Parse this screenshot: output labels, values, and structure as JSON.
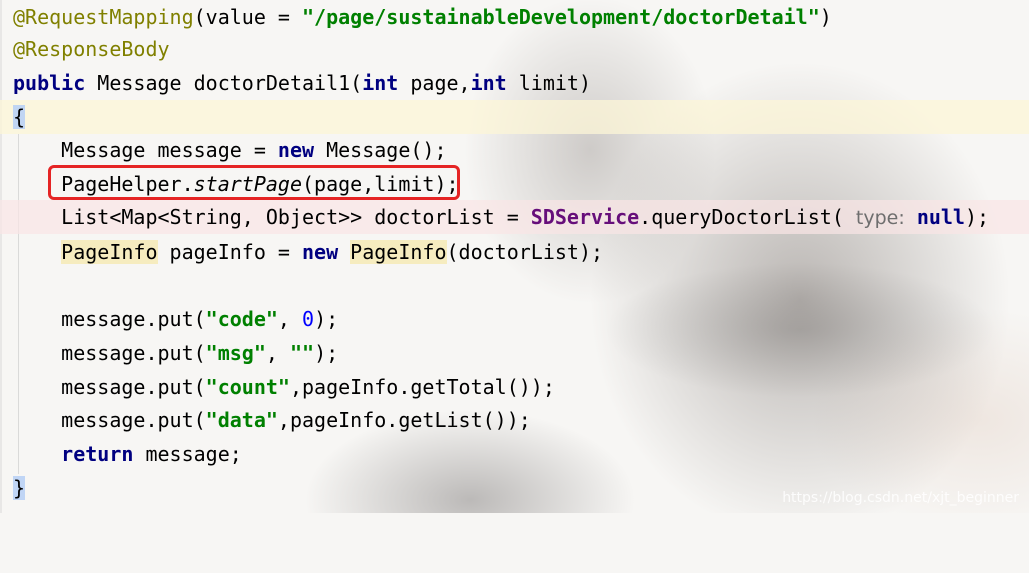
{
  "code": {
    "line1": {
      "annotation": "@RequestMapping",
      "paren_open": "(value = ",
      "string": "\"/page/sustainableDevelopment/doctorDetail\"",
      "paren_close": ")"
    },
    "line2": {
      "annotation": "@ResponseBody"
    },
    "line3": {
      "kw_public": "public",
      "rest1": " Message doctorDetail1(",
      "kw_int1": "int",
      "rest2": " page,",
      "kw_int2": "int",
      "rest3": " limit)"
    },
    "line4": {
      "brace": "{"
    },
    "line5": {
      "indent": "    ",
      "rest1": "Message message = ",
      "kw_new": "new",
      "rest2": " Message();"
    },
    "line6": {
      "indent": "    ",
      "rest1": "PageHelper.",
      "method": "startPage",
      "rest2": "(page,limit);"
    },
    "line7": {
      "indent": "    ",
      "rest1": "List<Map<String, Object>> doctorList = ",
      "field": "SDService",
      "rest2": ".queryDoctorList( ",
      "hint": "type:",
      "space": " ",
      "kw_null": "null",
      "rest3": ");"
    },
    "line8": {
      "indent": "    ",
      "type1": "PageInfo",
      "rest1": " pageInfo = ",
      "kw_new": "new",
      "space": " ",
      "type2": "PageInfo",
      "rest2": "(doctorList);"
    },
    "line9": {
      "text": ""
    },
    "line10": {
      "indent": "    ",
      "rest1": "message.put(",
      "string": "\"code\"",
      "rest2": ", ",
      "num": "0",
      "rest3": ");"
    },
    "line11": {
      "indent": "    ",
      "rest1": "message.put(",
      "string1": "\"msg\"",
      "rest2": ", ",
      "string2": "\"\"",
      "rest3": ");"
    },
    "line12": {
      "indent": "    ",
      "rest1": "message.put(",
      "string": "\"count\"",
      "rest2": ",pageInfo.getTotal());"
    },
    "line13": {
      "indent": "    ",
      "rest1": "message.put(",
      "string": "\"data\"",
      "rest2": ",pageInfo.getList());"
    },
    "line14": {
      "indent": "    ",
      "kw_return": "return",
      "rest1": " message;"
    },
    "line15": {
      "brace": "}"
    }
  },
  "watermark": "https://blog.csdn.net/xjt_beginner",
  "colors": {
    "annotation": "#808000",
    "keyword": "#000080",
    "string": "#008000",
    "number": "#0000ff",
    "field": "#660e7a",
    "highlight_box": "#e52424"
  }
}
